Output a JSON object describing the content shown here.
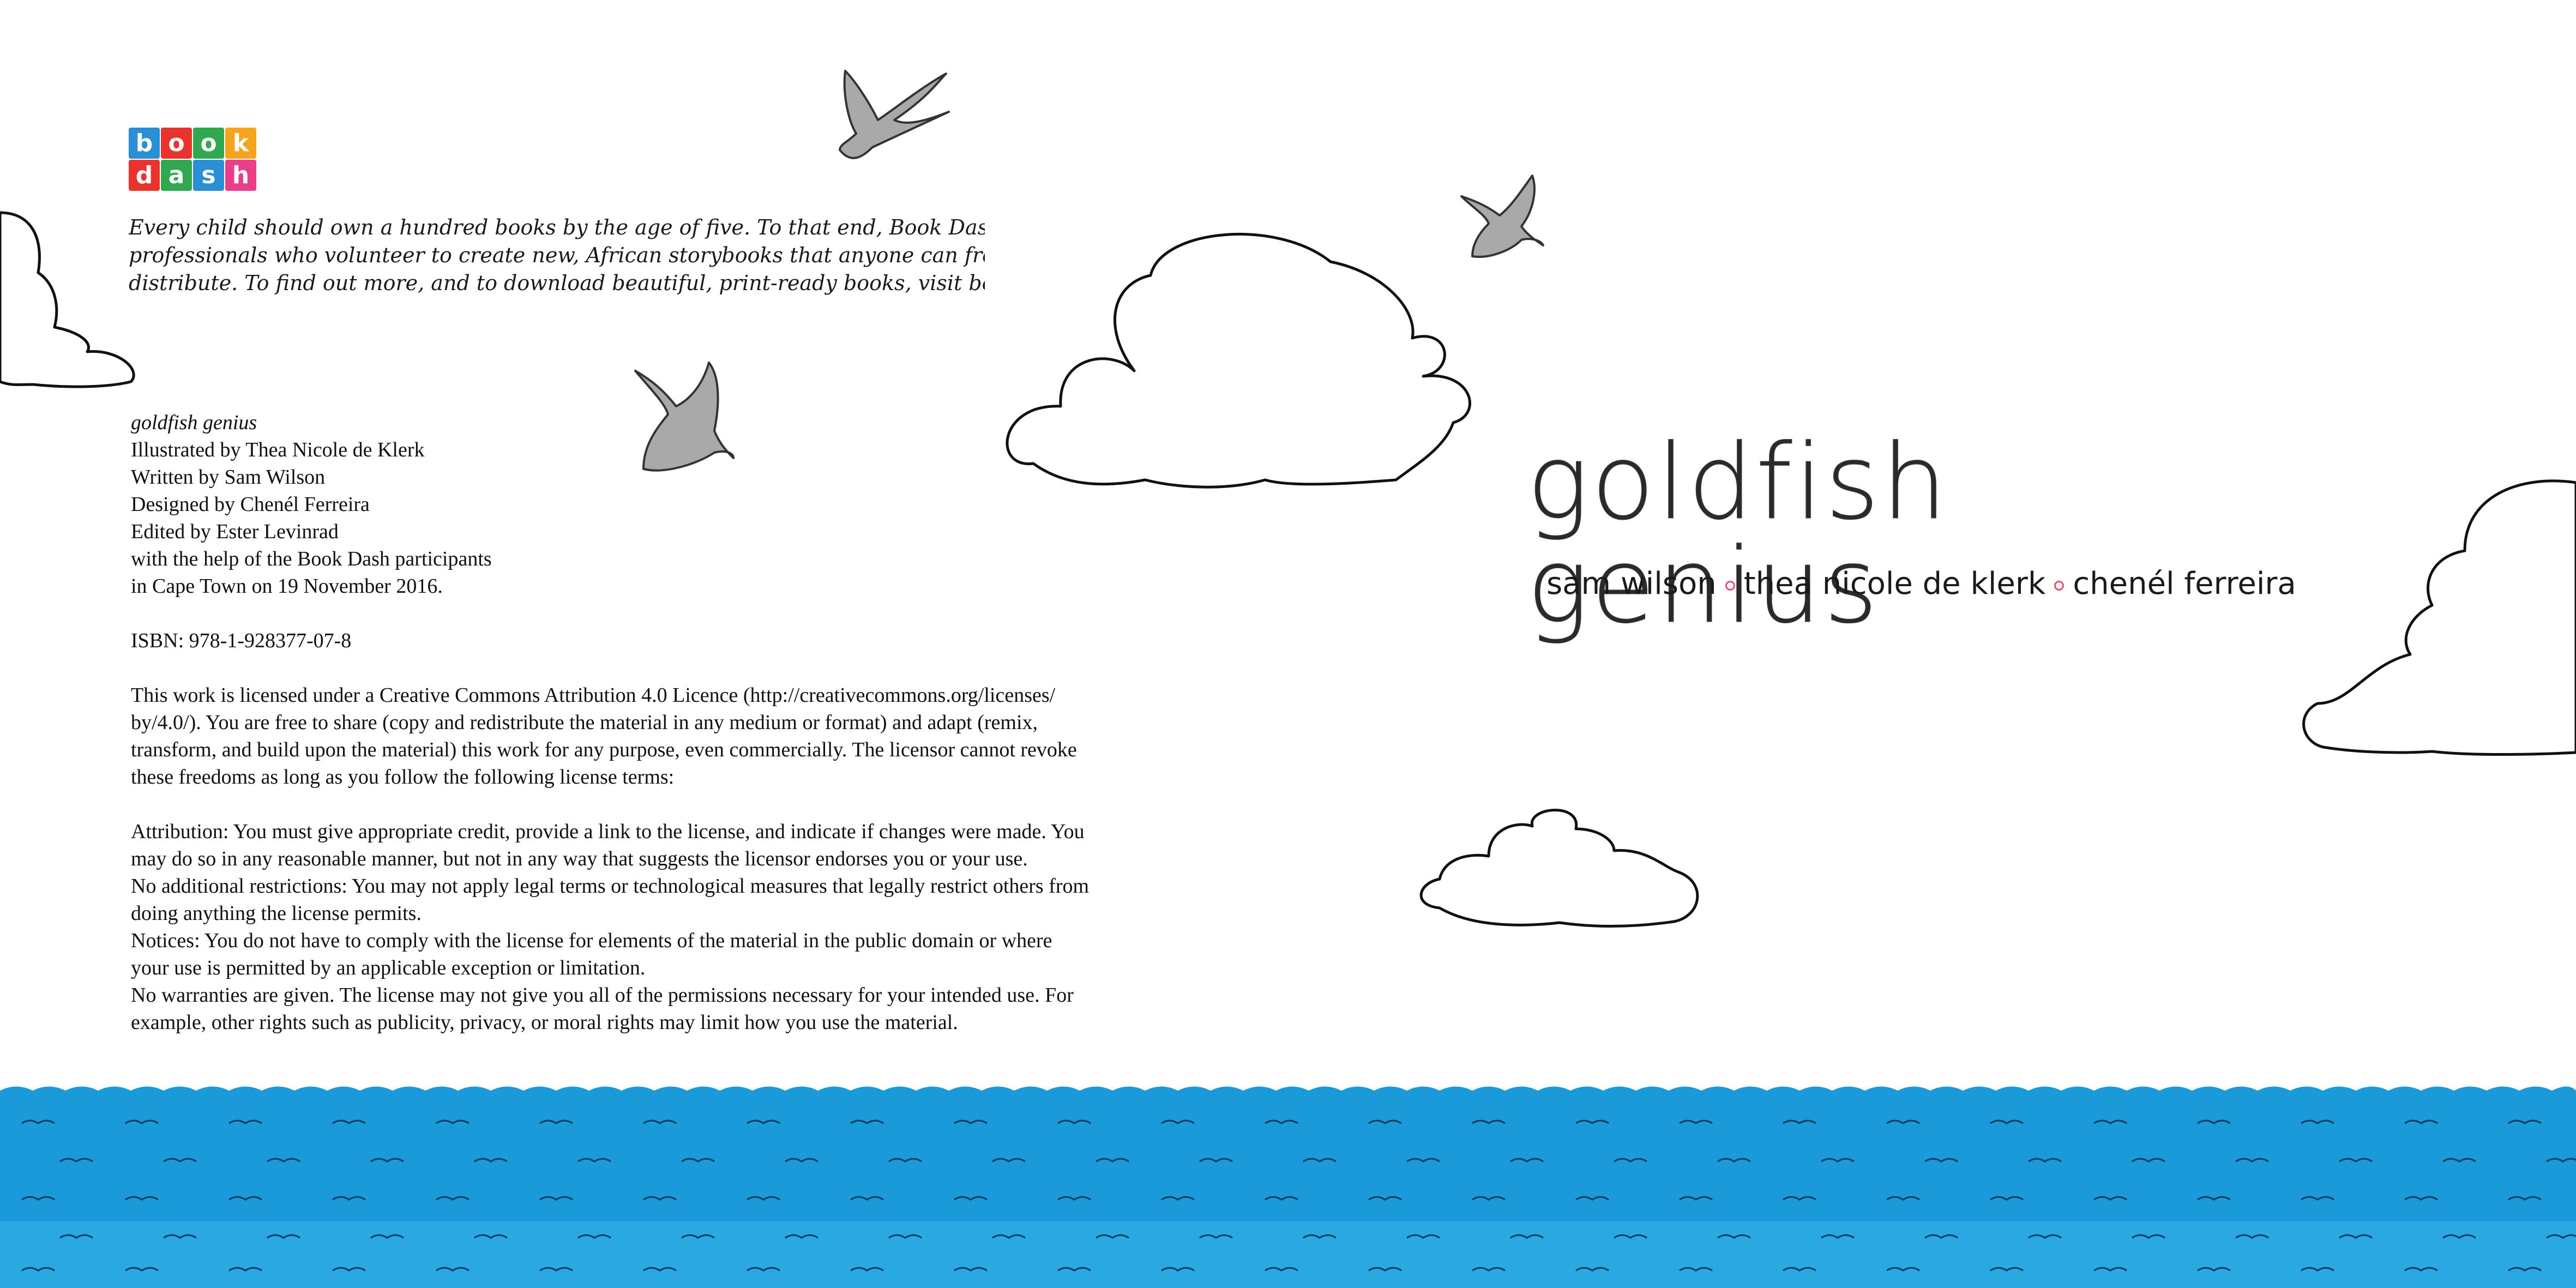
{
  "logo": {
    "letters": [
      "b",
      "o",
      "o",
      "k",
      "d",
      "a",
      "s",
      "h"
    ],
    "colors": [
      "#2b8fd6",
      "#e8342c",
      "#2fa84f",
      "#f4a51c",
      "#e8342c",
      "#2fa84f",
      "#2b8fd6",
      "#e83e8c"
    ]
  },
  "mission": {
    "lines": [
      "Every child should own a hundred books by the age of five. To that end, Book Dash gathers creat",
      "professionals who volunteer to create new, African storybooks that anyone can freely translate an",
      "distribute. To find out more, and to download beautiful, print-ready books, visit bookdash.org."
    ]
  },
  "credits": {
    "book_title": "goldfish genius",
    "illustrated": "Illustrated by Thea Nicole de Klerk",
    "written": "Written by Sam Wilson",
    "designed": "Designed by Chenél Ferreira",
    "edited": "Edited by Ester Levinrad",
    "help": "with the help of the Book Dash participants",
    "place_date": "in Cape Town on 19 November 2016.",
    "isbn": "ISBN: 978-1-928377-07-8"
  },
  "license": {
    "intro": [
      "This work is licensed under a Creative Commons Attribution 4.0 Licence (http://creativecommons.org/licenses/",
      "by/4.0/). You are free to share (copy and redistribute the material in any medium or format) and adapt (remix,",
      "transform, and build upon the material) this work for any purpose, even commercially. The licensor cannot revoke",
      "these freedoms as long as you follow the following license terms:"
    ],
    "terms": [
      "Attribution: You must give appropriate credit, provide a link to the license, and indicate if changes were made. You",
      "may do so in any reasonable manner, but not in any way that suggests the licensor endorses you or your use.",
      "No additional restrictions: You may not apply legal terms or technological measures that legally restrict others from",
      "doing anything the license permits.",
      "Notices: You do not have to comply with the license for elements of the material in the public domain or where",
      "your use is permitted by an applicable exception or limitation.",
      "No warranties are given. The license may not give you all of the permissions necessary for your intended use. For",
      "example, other rights such as publicity, privacy, or moral rights may limit how you use the material."
    ]
  },
  "cover": {
    "title": "goldfish genius",
    "authors": [
      "sam wilson",
      "thea nicole de klerk",
      "chenél ferreira"
    ]
  },
  "colors": {
    "sea": "#1a9ad8",
    "sea_light": "#2aa8e2",
    "bird": "#a9a9a9",
    "outline": "#111111",
    "separator": "#e05070"
  }
}
